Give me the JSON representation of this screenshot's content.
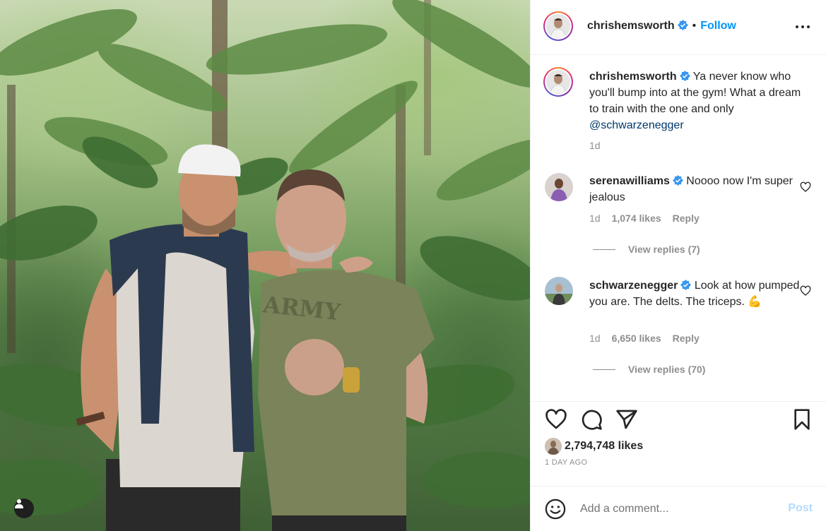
{
  "post": {
    "author": "chrishemsworth",
    "follow_label": "Follow",
    "dot": "•"
  },
  "caption": {
    "username": "chrishemsworth",
    "text": "Ya never know who you'll bump into at the gym! What a dream to train with the one and only",
    "mention": "@schwarzenegger",
    "time": "1d"
  },
  "comments": [
    {
      "username": "serenawilliams",
      "text": "Noooo now I'm super jealous",
      "time": "1d",
      "likes": "1,074 likes",
      "reply": "Reply",
      "view_replies": "View replies (7)"
    },
    {
      "username": "schwarzenegger",
      "text": "Look at how pumped you are. The delts. The triceps.",
      "emoji": "💪",
      "time": "1d",
      "likes": "6,650 likes",
      "reply": "Reply",
      "view_replies": "View replies (70)"
    }
  ],
  "stats": {
    "likes": "2,794,748 likes",
    "time_ago": "1 DAY AGO"
  },
  "composer": {
    "placeholder": "Add a comment...",
    "post_label": "Post"
  },
  "colors": {
    "accent": "#0095f6",
    "verified": "#3897f0",
    "post_disabled": "#b3dbff"
  },
  "icons": {
    "more": "more-horizontal-icon",
    "like": "heart-icon",
    "comment": "comment-bubble-icon",
    "share": "paper-plane-icon",
    "save": "bookmark-icon",
    "emoji": "smiley-icon",
    "tag": "user-tag-icon"
  }
}
